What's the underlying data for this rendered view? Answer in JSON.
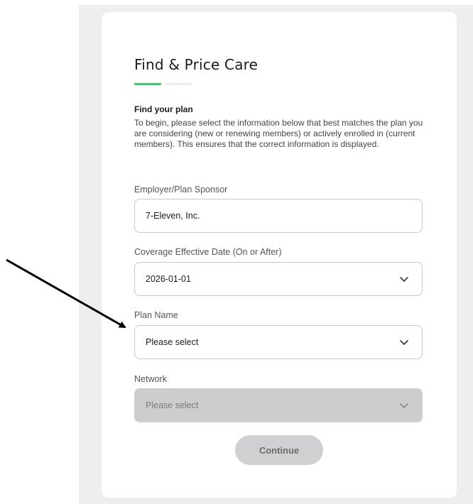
{
  "card": {
    "title": "Find & Price Care",
    "progress_step": 1,
    "progress_total": 2,
    "section_heading": "Find your plan",
    "section_description": "To begin, please select the information below that best matches the plan you are considering (new or renewing members) or actively enrolled in (current members). This ensures that the correct information is displayed."
  },
  "fields": {
    "employer": {
      "label": "Employer/Plan Sponsor",
      "value": "7-Eleven, Inc."
    },
    "coverage_date": {
      "label": "Coverage Effective Date (On or After)",
      "value": "2026-01-01",
      "icon": "chevron-down-icon"
    },
    "plan_name": {
      "label": "Plan Name",
      "value": "Please select",
      "icon": "chevron-down-icon"
    },
    "network": {
      "label": "Network",
      "value": "Please select",
      "icon": "chevron-down-icon",
      "disabled": true
    }
  },
  "buttons": {
    "continue_label": "Continue",
    "continue_disabled": true
  },
  "annotation": {
    "icon": "arrow-pointer-icon",
    "color": "#000000"
  },
  "colors": {
    "accent": "#2fd25c",
    "background_panel": "#eeeeee",
    "disabled_fill": "#cdcdd0"
  }
}
